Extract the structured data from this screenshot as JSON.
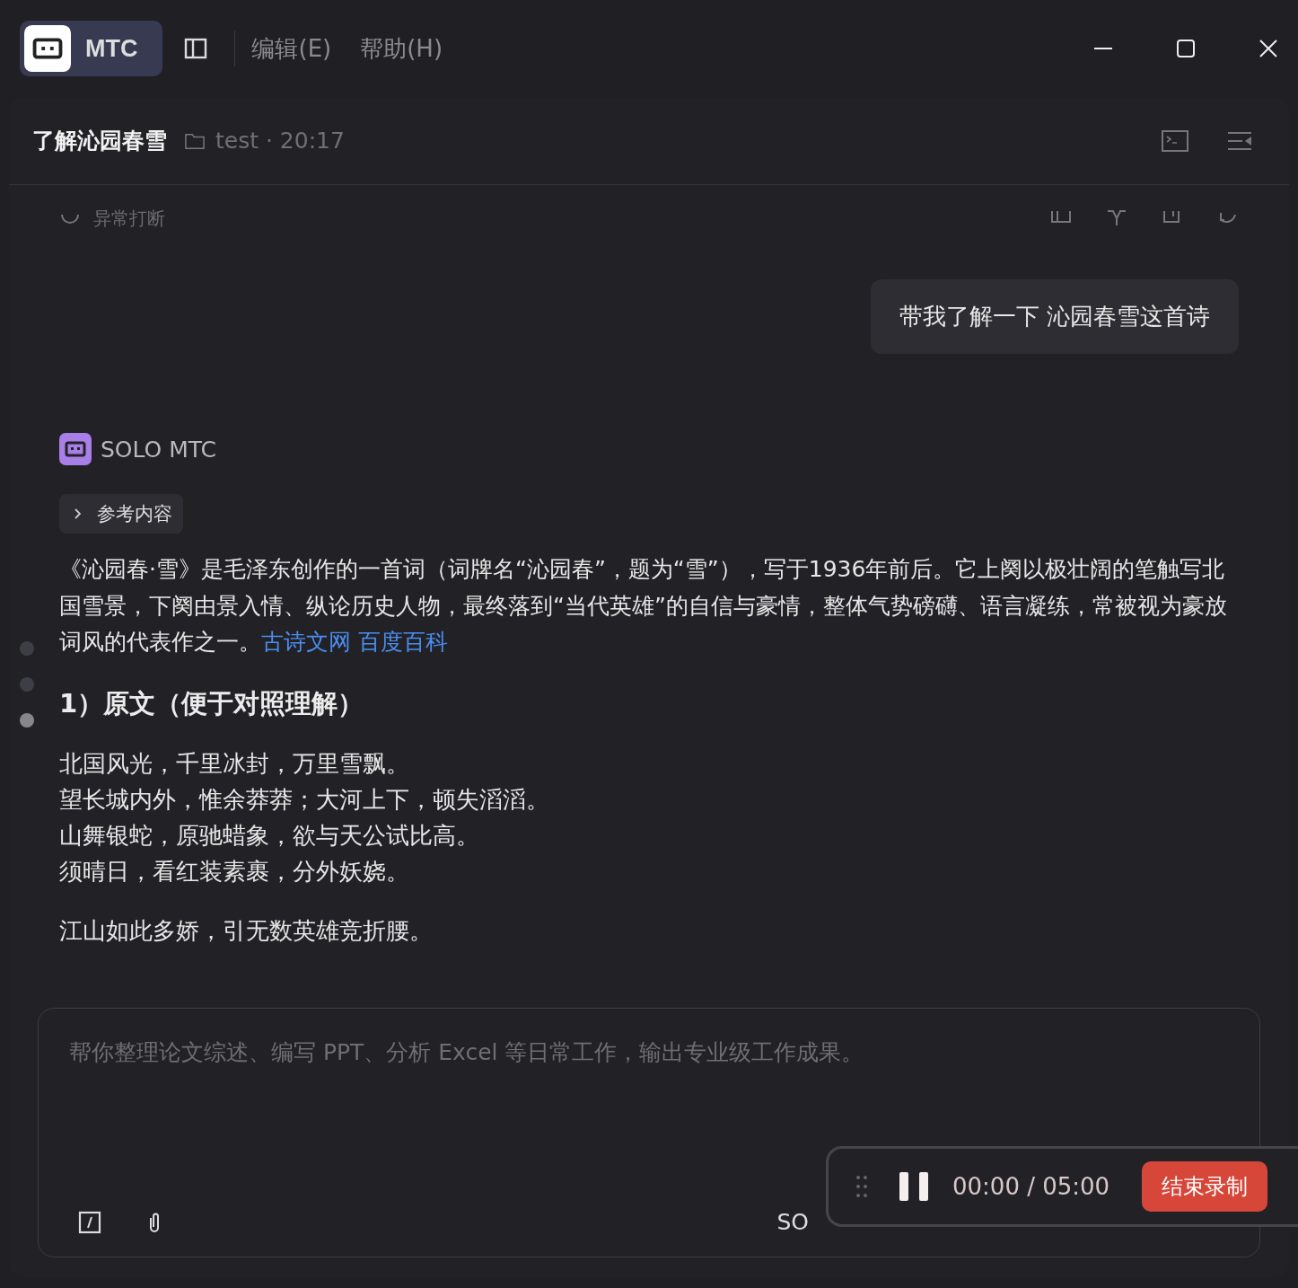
{
  "app": {
    "name": "MTC",
    "menus": [
      {
        "label": "编辑(E)"
      },
      {
        "label": "帮助(H)"
      }
    ]
  },
  "conversation": {
    "title": "了解沁园春雪",
    "folder": "test · 20:17"
  },
  "notice": {
    "text": "异常打断"
  },
  "user_message": {
    "text": "带我了解一下 沁园春雪这首诗"
  },
  "assistant": {
    "name": "SOLO MTC",
    "references": {
      "label": "参考内容",
      "expanded": false
    },
    "paragraph": "《沁园春·雪》是毛泽东创作的一首词（词牌名“沁园春”，题为“雪”），写于1936年前后。它上阕以极壮阔的笔触写北国雪景，下阕由景入情、纵论历史人物，最终落到“当代英雄”的自信与豪情，整体气势磅礴、语言凝练，常被视为豪放词风的代表作之一。",
    "links": [
      {
        "label": "古诗文网"
      },
      {
        "label": "百度百科"
      }
    ],
    "heading": "1）原文（便于对照理解）",
    "stanzas": [
      [
        "北国风光，千里冰封，万里雪飘。",
        "望长城内外，惟余莽莽；大河上下，顿失滔滔。",
        "山舞银蛇，原驰蜡象，欲与天公试比高。",
        "须晴日，看红装素裹，分外妖娆。"
      ],
      [
        "江山如此多娇，引无数英雄竞折腰。"
      ]
    ]
  },
  "nav_dots": [
    {
      "selected": false
    },
    {
      "selected": false
    },
    {
      "selected": true
    }
  ],
  "composer": {
    "placeholder": "帮你整理论文综述、编写 PPT、分析 Excel 等日常工作，输出专业级工作成果。",
    "mode_label": "SO"
  },
  "recorder": {
    "time": "00:00 / 05:00",
    "stop_button": "结束录制"
  }
}
